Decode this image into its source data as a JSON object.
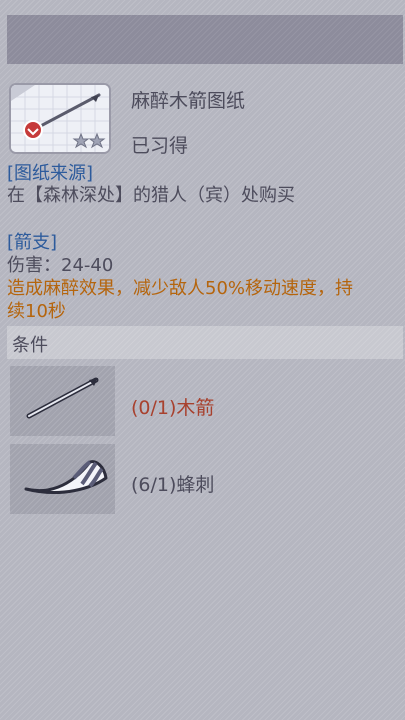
{
  "item": {
    "name": "麻醉木箭图纸",
    "status": "已习得",
    "stars": 2,
    "icon": "blueprint-arrow-icon"
  },
  "source": {
    "header": "[图纸来源]",
    "text": "在【森林深处】的猎人（宾）处购买"
  },
  "arrow": {
    "header": "[箭支]",
    "damage": "伤害：24-40",
    "effect_line1": "造成麻醉效果，减少敌人50%移动速度，持",
    "effect_line2": "续10秒"
  },
  "conditions": {
    "label": "条件",
    "items": [
      {
        "text": "(0/1)木箭",
        "icon": "wooden-arrow-icon",
        "color": "#a8412e"
      },
      {
        "text": "(6/1)蜂刺",
        "icon": "bee-stinger-icon",
        "color": "#4d4c5c"
      }
    ]
  },
  "colors": {
    "background": "#b5b6c0",
    "title_bar": "#8d8c9c",
    "header_blue": "#2d5b9c",
    "effect_orange": "#b5650d",
    "missing_red": "#a8412e"
  }
}
